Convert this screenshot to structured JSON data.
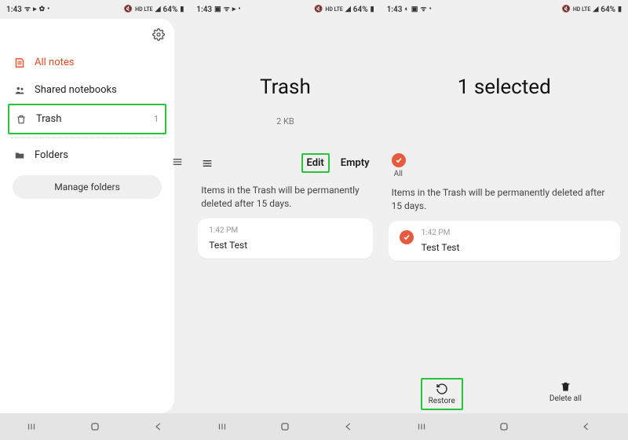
{
  "status": {
    "time": "1:43",
    "signal": "HD LTE",
    "battery": "64%"
  },
  "drawer": {
    "items": [
      {
        "label": "All notes"
      },
      {
        "label": "Shared notebooks"
      },
      {
        "label": "Trash",
        "count": "1"
      },
      {
        "label": "Folders"
      }
    ],
    "manage": "Manage folders"
  },
  "trash": {
    "title": "Trash",
    "size": "2 KB",
    "edit": "Edit",
    "empty": "Empty",
    "info": "Items in the Trash will be permanently deleted after 15 days.",
    "note": {
      "time": "1:42 PM",
      "title": "Test Test"
    }
  },
  "selection": {
    "title": "1 selected",
    "all": "All",
    "restore": "Restore",
    "delete_all": "Delete all"
  }
}
